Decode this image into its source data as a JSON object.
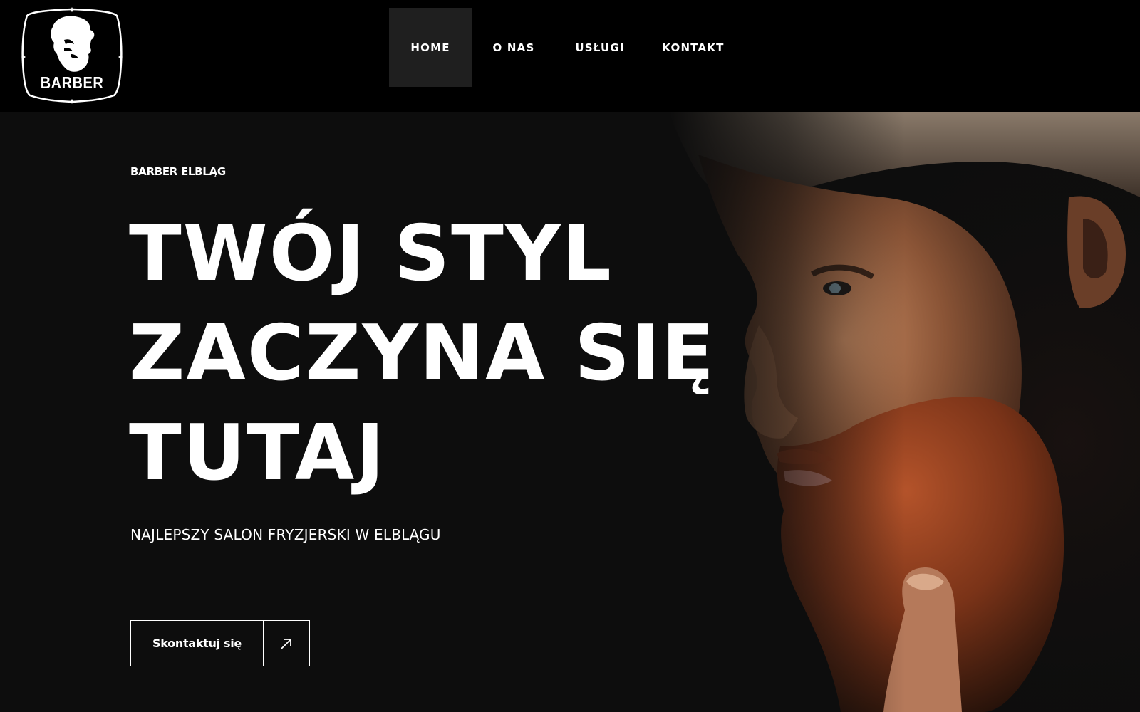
{
  "brand": {
    "logo_text": "BARBER",
    "logo_icon": "bearded-man-logo-icon"
  },
  "nav": {
    "items": [
      {
        "label": "HOME",
        "active": true
      },
      {
        "label": "O NAS",
        "active": false
      },
      {
        "label": "USŁUGI",
        "active": false
      },
      {
        "label": "KONTAKT",
        "active": false
      }
    ]
  },
  "hero": {
    "eyebrow": "BARBER ELBLĄG",
    "headline_lines": [
      "TWÓJ STYL",
      "ZACZYNA SIĘ",
      "TUTAJ"
    ],
    "subtitle": "NAJLEPSZY SALON FRYZJERSKI W ELBLĄGU",
    "cta_label": "Skontaktuj się",
    "cta_icon": "arrow-up-right-icon",
    "photo": "bearded-man-profile-photo"
  },
  "colors": {
    "header_bg": "#000000",
    "hero_bg": "#0d0d0d",
    "nav_active_bg": "#1f1f1f",
    "text": "#ffffff",
    "beard_accent": "#8c3a1a"
  }
}
